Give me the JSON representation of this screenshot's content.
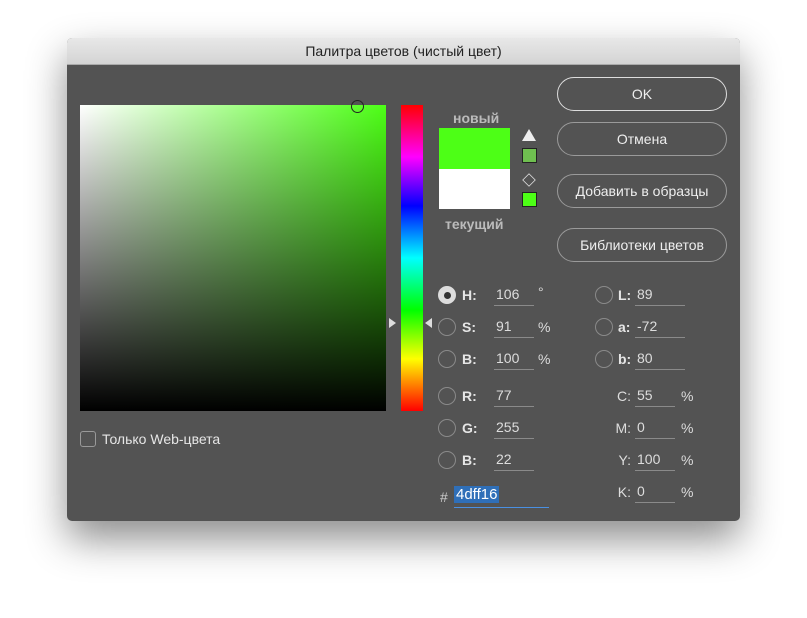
{
  "title": "Палитра цветов (чистый цвет)",
  "buttons": {
    "ok": "OK",
    "cancel": "Отмена",
    "add_swatch": "Добавить в образцы",
    "libraries": "Библиотеки цветов"
  },
  "preview": {
    "new_label": "новый",
    "current_label": "текущий",
    "new_color": "#4dff16",
    "current_color": "#ffffff",
    "gamut_color": "#6fbf50",
    "web_color": "#4dff16"
  },
  "web_only": "Только Web-цвета",
  "hsb": [
    {
      "key": "H:",
      "value": "106",
      "unit": "°"
    },
    {
      "key": "S:",
      "value": "91",
      "unit": "%"
    },
    {
      "key": "B:",
      "value": "100",
      "unit": "%"
    }
  ],
  "rgb": [
    {
      "key": "R:",
      "value": "77"
    },
    {
      "key": "G:",
      "value": "255"
    },
    {
      "key": "B:",
      "value": "22"
    }
  ],
  "lab": [
    {
      "key": "L:",
      "value": "89"
    },
    {
      "key": "a:",
      "value": "-72"
    },
    {
      "key": "b:",
      "value": "80"
    }
  ],
  "cmyk": [
    {
      "key": "C:",
      "value": "55",
      "unit": "%"
    },
    {
      "key": "M:",
      "value": "0",
      "unit": "%"
    },
    {
      "key": "Y:",
      "value": "100",
      "unit": "%"
    },
    {
      "key": "K:",
      "value": "0",
      "unit": "%"
    }
  ],
  "hex": {
    "prefix": "#",
    "value": "4dff16"
  }
}
